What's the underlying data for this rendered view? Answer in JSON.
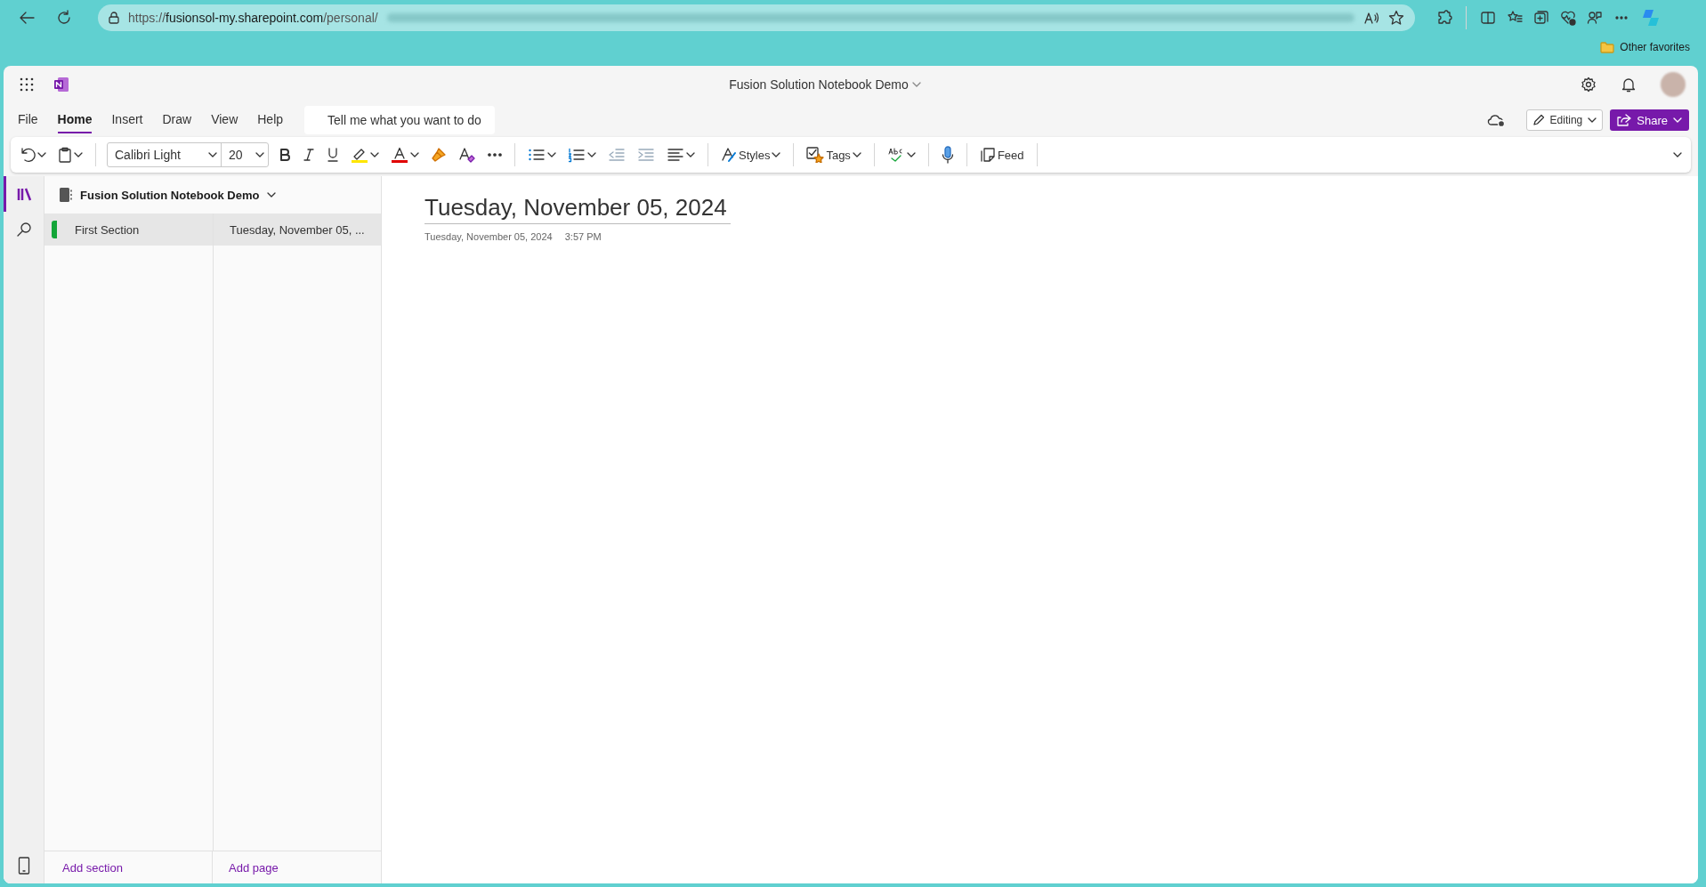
{
  "browser": {
    "url": {
      "scheme": "https://",
      "host": "fusionsol-my.sharepoint.com",
      "path": "/personal/"
    },
    "bookmarks": [
      "Other favorites"
    ]
  },
  "app": {
    "title": "Fusion Solution Notebook Demo"
  },
  "menu_tabs": [
    {
      "label": "File",
      "selected": false
    },
    {
      "label": "Home",
      "selected": true
    },
    {
      "label": "Insert",
      "selected": false
    },
    {
      "label": "Draw",
      "selected": false
    },
    {
      "label": "View",
      "selected": false
    },
    {
      "label": "Help",
      "selected": false
    }
  ],
  "search": {
    "placeholder": "Tell me what you want to do"
  },
  "mode_button": "Editing",
  "share_button": "Share",
  "toolbar": {
    "font": "Calibri Light",
    "size": "20",
    "styles": "Styles",
    "tags": "Tags",
    "feed": "Feed"
  },
  "notebook": {
    "name": "Fusion Solution Notebook Demo"
  },
  "sections": [
    {
      "name": "First Section",
      "color": "#13a538",
      "selected": true
    }
  ],
  "pages": [
    {
      "title": "Tuesday, November 05, ...",
      "selected": true
    }
  ],
  "add_section": "Add section",
  "add_page": "Add page",
  "page": {
    "title": "Tuesday, November 05, 2024",
    "date": "Tuesday, November 05, 2024",
    "time": "3:57 PM"
  }
}
